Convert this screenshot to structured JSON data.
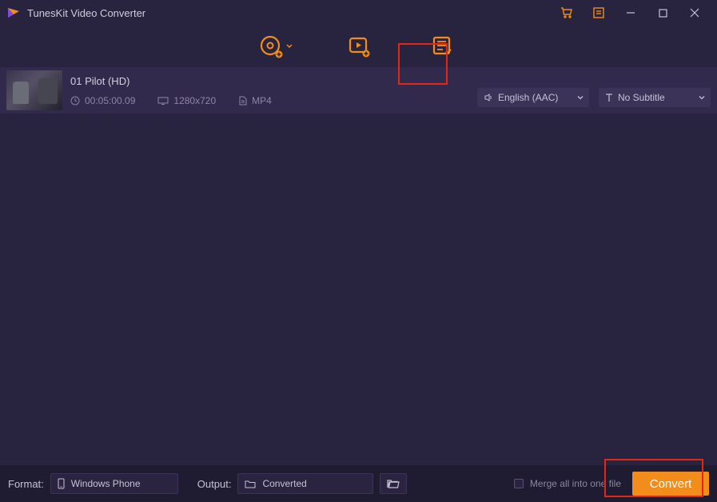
{
  "titlebar": {
    "title": "TunesKit Video Converter"
  },
  "toolbar": {
    "buttons": [
      "disc-add",
      "play-add",
      "preset-list"
    ]
  },
  "file": {
    "title": "01 Pilot (HD)",
    "duration": "00:05:00.09",
    "resolution": "1280x720",
    "container": "MP4",
    "audio_label": "English (AAC)",
    "subtitle_label": "No Subtitle"
  },
  "bottom": {
    "format_label": "Format:",
    "format_value": "Windows Phone",
    "output_label": "Output:",
    "output_value": "Converted",
    "merge_label": "Merge all into one file",
    "convert_label": "Convert"
  }
}
